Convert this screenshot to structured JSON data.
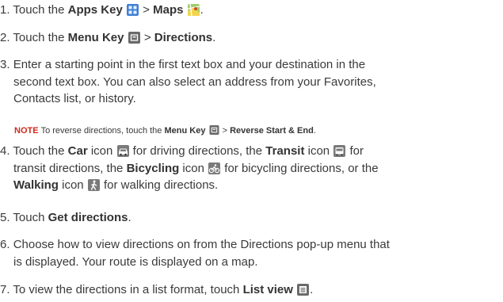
{
  "steps": [
    {
      "num": "1.",
      "t1": "Touch the ",
      "b1": "Apps Key",
      "t2": " > ",
      "b2": "Maps",
      "t3": "."
    },
    {
      "num": "2.",
      "t1": "Touch the ",
      "b1": "Menu Key",
      "t2": " > ",
      "b2": "Directions",
      "t3": "."
    },
    {
      "num": "3.",
      "line1": "Enter a starting point in the first text box and your destination in the",
      "line2": "second text box. You can also select an address from your Favorites,",
      "line3": "Contacts list, or history."
    },
    {
      "num": "4.",
      "t1": "Touch the ",
      "b1": "Car",
      "t2": " icon ",
      "t3": " for driving directions, the ",
      "b2": "Transit",
      "t4": " icon ",
      "t5": " for",
      "t6": "transit directions, the ",
      "b3": "Bicycling",
      "t7": " icon ",
      "t8": " for bicycling directions, or the",
      "b4": "Walking",
      "t9": " icon ",
      "t10": " for walking directions."
    },
    {
      "num": "5.",
      "t1": "Touch ",
      "b1": "Get directions",
      "t2": "."
    },
    {
      "num": "6.",
      "line1": "Choose how to view directions on from the Directions pop-up menu that",
      "line2": "is displayed. Your route is displayed on a map."
    },
    {
      "num": "7.",
      "t1": "To view the directions in a list format, touch ",
      "b1": "List view",
      "t2": "."
    }
  ],
  "note": {
    "label": "NOTE",
    "t1": "To reverse directions, touch the ",
    "b1": "Menu Key",
    "t2": " > ",
    "b2": "Reverse Start & End",
    "t3": "."
  },
  "icons": {
    "apps": "apps-grid-icon",
    "maps": "maps-icon",
    "menu": "menu-key-icon",
    "car": "car-icon",
    "transit": "transit-icon",
    "bicycle": "bicycle-icon",
    "walking": "walking-icon",
    "list": "list-view-icon"
  }
}
